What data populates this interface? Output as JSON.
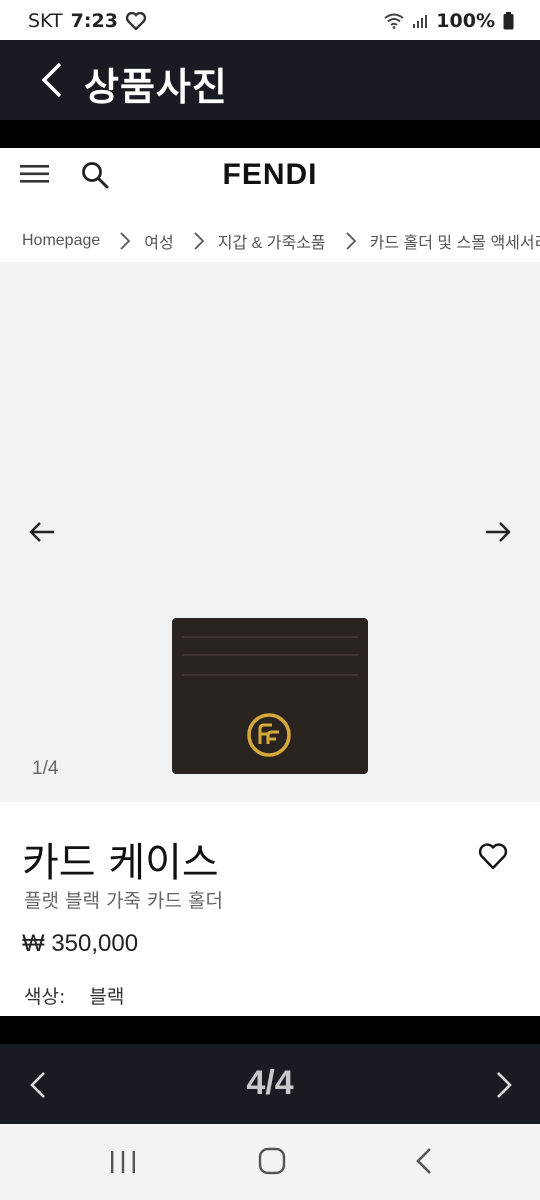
{
  "status_bar": {
    "carrier": "SKT",
    "time": "7:23",
    "battery": "100%"
  },
  "app_header": {
    "title": "상품사진"
  },
  "site": {
    "brand": "FENDI",
    "breadcrumb": [
      "Homepage",
      "여성",
      "지갑 & 가죽소품",
      "카드 홀더 및 스몰 액세서리"
    ]
  },
  "gallery": {
    "counter": "1/4"
  },
  "product": {
    "title": "카드 케이스",
    "subtitle": "플랫 블랙 가죽 카드 홀더",
    "price": "₩ 350,000",
    "color_label": "색상:",
    "color_value": "블랙"
  },
  "viewer": {
    "counter": "4/4"
  },
  "colors": {
    "header_bg": "#1a1a22",
    "gallery_bg": "#f2f2f2",
    "product_leather": "#2a2421",
    "logo_gold": "#d4a93a"
  }
}
